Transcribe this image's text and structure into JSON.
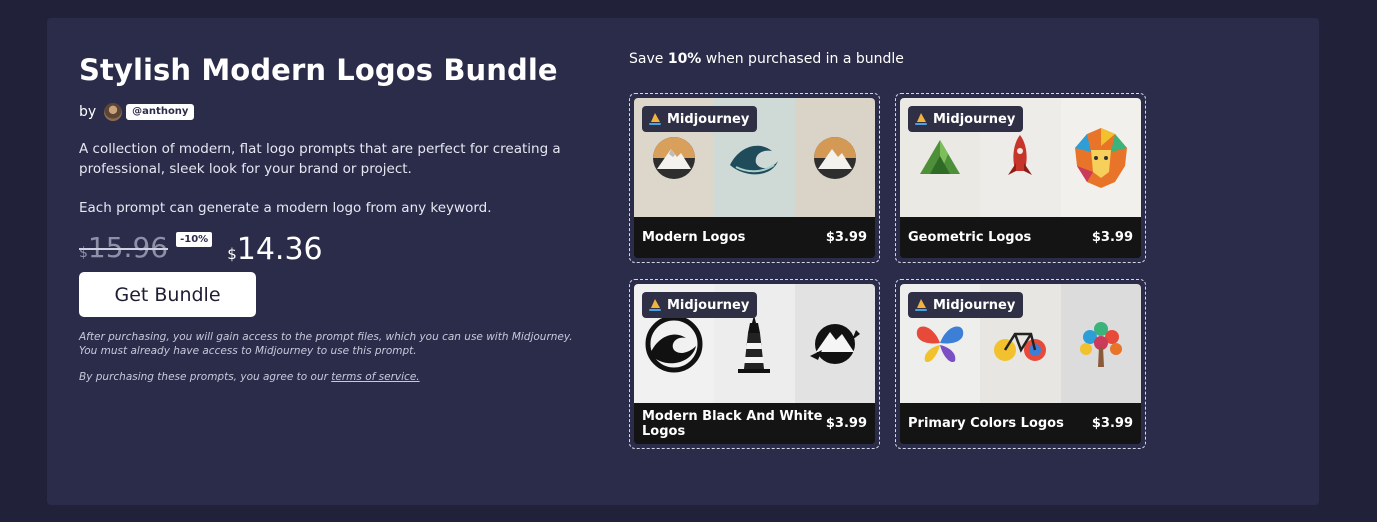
{
  "bundle": {
    "title": "Stylish Modern Logos Bundle",
    "by_label": "by",
    "author_handle": "@anthony",
    "description": "A collection of modern, flat logo prompts that are perfect for creating a professional, sleek look for your brand or project.",
    "description_2": "Each prompt can generate a modern logo from any keyword.",
    "currency_symbol": "$",
    "old_price": "15.96",
    "discount_badge": "-10%",
    "new_price": "14.36",
    "cta_label": "Get Bundle",
    "fine_print": "After purchasing, you will gain access to the prompt files, which you can use with Midjourney. You must already have access to Midjourney to use this prompt.",
    "tos_prefix": "By purchasing these prompts, you agree to our ",
    "tos_link": "terms of service."
  },
  "savings": {
    "prefix": "Save ",
    "percent": "10%",
    "suffix": " when purchased in a bundle"
  },
  "cards": [
    {
      "engine": "Midjourney",
      "name": "Modern Logos",
      "price": "$3.99",
      "thumbs": [
        "mountain-logo",
        "wave-logo",
        "mountain-logo"
      ],
      "thumb_bg": [
        "#dcd6cb",
        "#cfd9d6",
        "#d9d3c8"
      ]
    },
    {
      "engine": "Midjourney",
      "name": "Geometric Logos",
      "price": "$3.99",
      "thumbs": [
        "green-mountain-logo",
        "rocket-logo",
        "lion-logo"
      ],
      "thumb_bg": [
        "#ebe9e4",
        "#eeece8",
        "#f2f0ec"
      ]
    },
    {
      "engine": "Midjourney",
      "name": "Modern Black And White Logos",
      "price": "$3.99",
      "thumbs": [
        "wave-circle-logo",
        "lighthouse-logo",
        "mountain-splash-logo"
      ],
      "thumb_bg": [
        "#f1f1f1",
        "#ededed",
        "#e2e2e2"
      ]
    },
    {
      "engine": "Midjourney",
      "name": "Primary Colors Logos",
      "price": "$3.99",
      "thumbs": [
        "butterfly-logo",
        "bicycle-logo",
        "tree-logo"
      ],
      "thumb_bg": [
        "#eeeeec",
        "#e8e6e2",
        "#dcdcdc"
      ]
    }
  ]
}
